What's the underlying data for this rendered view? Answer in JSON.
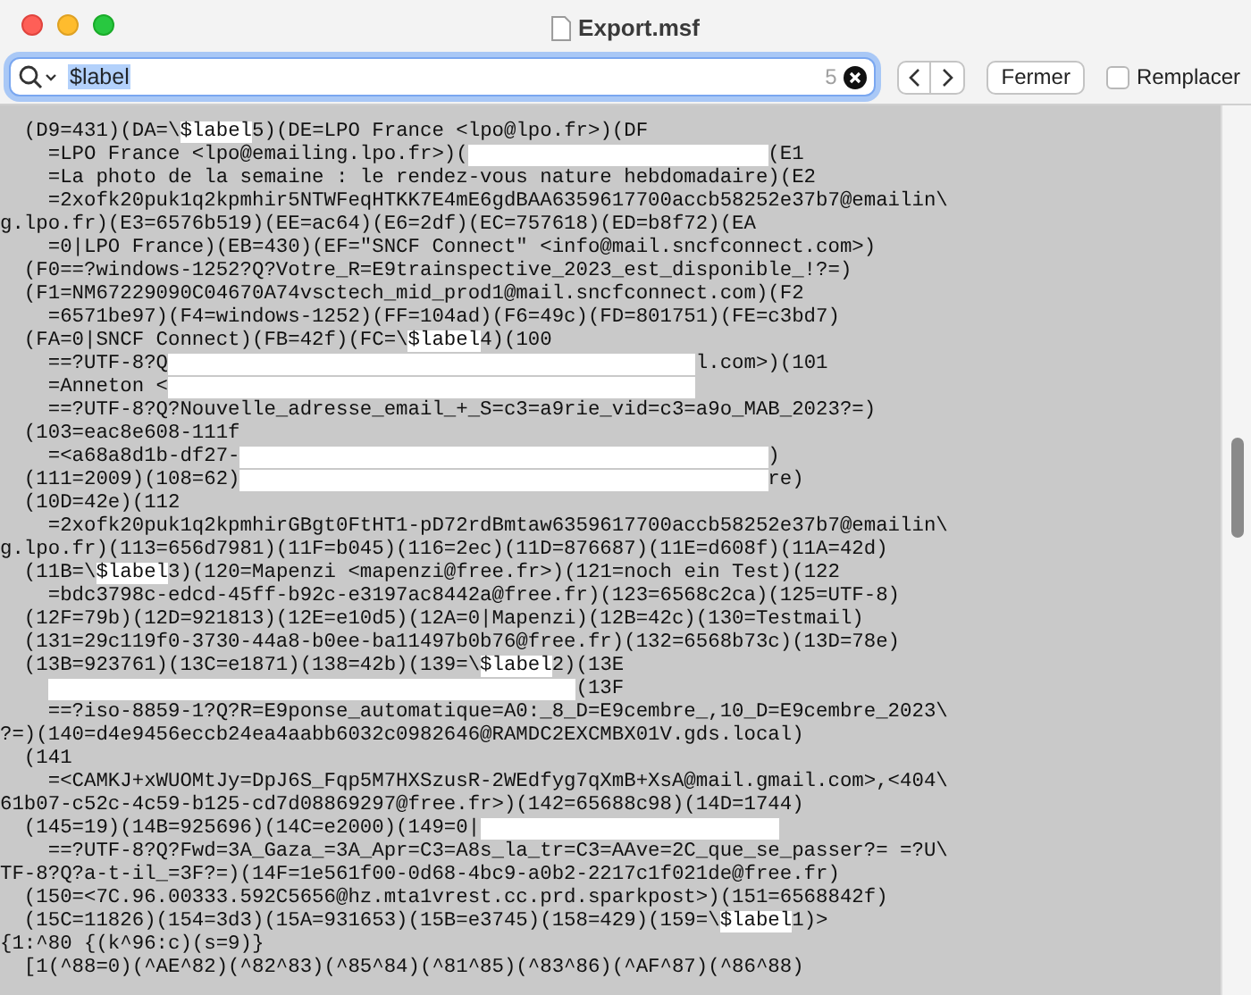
{
  "window": {
    "title": "Export.msf"
  },
  "find_bar": {
    "query": "$label",
    "match_count": "5",
    "close_button": "Fermer",
    "replace": {
      "label": "Remplacer",
      "checked": false
    }
  },
  "text_lines": [
    {
      "segments": [
        {
          "kind": "text",
          "text": "  (D9=431)(DA=\\"
        },
        {
          "kind": "match",
          "text": "$label"
        },
        {
          "kind": "text",
          "text": "5)(DE=LPO France <lpo@lpo.fr>)(DF"
        }
      ]
    },
    {
      "segments": [
        {
          "kind": "text",
          "text": "    =LPO France <lpo@emailing.lpo.fr>)("
        },
        {
          "kind": "redacted-short"
        },
        {
          "kind": "text",
          "text": "(E1"
        }
      ]
    },
    {
      "segments": [
        {
          "kind": "text",
          "text": "    =La photo de la semaine : le rendez-vous nature hebdomadaire)(E2"
        }
      ]
    },
    {
      "segments": [
        {
          "kind": "text",
          "text": "    =2xofk20puk1q2kpmhir5NTWFeqHTKK7E4mE6gdBAA6359617700accb58252e37b7@emailin\\"
        }
      ]
    },
    {
      "segments": [
        {
          "kind": "text",
          "text": "g.lpo.fr)(E3=6576b519)(EE=ac64)(E6=2df)(EC=757618)(ED=b8f72)(EA"
        }
      ]
    },
    {
      "segments": [
        {
          "kind": "text",
          "text": "    =0|LPO France)(EB=430)(EF=\"SNCF Connect\" <info@mail.sncfconnect.com>)"
        }
      ]
    },
    {
      "segments": [
        {
          "kind": "text",
          "text": "  (F0==?windows-1252?Q?Votre_R=E9trainspective_2023_est_disponible_!?=)"
        }
      ]
    },
    {
      "segments": [
        {
          "kind": "text",
          "text": "  (F1=NM67229090C04670A74vsctech_mid_prod1@mail.sncfconnect.com)(F2"
        }
      ]
    },
    {
      "segments": [
        {
          "kind": "text",
          "text": "    =6571be97)(F4=windows-1252)(FF=104ad)(F6=49c)(FD=801751)(FE=c3bd7)"
        }
      ]
    },
    {
      "segments": [
        {
          "kind": "text",
          "text": "  (FA=0|SNCF Connect)(FB=42f)(FC=\\"
        },
        {
          "kind": "match",
          "text": "$label"
        },
        {
          "kind": "text",
          "text": "4)(100"
        }
      ]
    },
    {
      "segments": [
        {
          "kind": "text",
          "text": "    ==?UTF-8?Q"
        },
        {
          "kind": "redacted"
        },
        {
          "kind": "text",
          "text": "l.com>)(101"
        }
      ]
    },
    {
      "segments": [
        {
          "kind": "text",
          "text": "    =Anneton <"
        },
        {
          "kind": "redacted"
        }
      ]
    },
    {
      "segments": [
        {
          "kind": "text",
          "text": "    ==?UTF-8?Q?Nouvelle_adresse_email_+_S=c3=a9rie_vid=c3=a9o_MAB_2023?=)"
        }
      ]
    },
    {
      "segments": [
        {
          "kind": "text",
          "text": "  (103=eac8e608-111f"
        }
      ]
    },
    {
      "segments": [
        {
          "kind": "text",
          "text": "    =<a68a8d1b-df27-"
        },
        {
          "kind": "redacted"
        },
        {
          "kind": "text",
          "text": ")"
        }
      ]
    },
    {
      "segments": [
        {
          "kind": "text",
          "text": "  (111=2009)(108=62)"
        },
        {
          "kind": "redacted"
        },
        {
          "kind": "text",
          "text": "re)"
        }
      ]
    },
    {
      "segments": [
        {
          "kind": "text",
          "text": "  (10D=42e)(112"
        }
      ]
    },
    {
      "segments": [
        {
          "kind": "text",
          "text": "    =2xofk20puk1q2kpmhirGBgt0FtHT1-pD72rdBmtaw6359617700accb58252e37b7@emailin\\"
        }
      ]
    },
    {
      "segments": [
        {
          "kind": "text",
          "text": "g.lpo.fr)(113=656d7981)(11F=b045)(116=2ec)(11D=876687)(11E=d608f)(11A=42d)"
        }
      ]
    },
    {
      "segments": [
        {
          "kind": "text",
          "text": "  (11B=\\"
        },
        {
          "kind": "match",
          "text": "$label"
        },
        {
          "kind": "text",
          "text": "3)(120=Mapenzi <mapenzi@free.fr>)(121=noch ein Test)(122"
        }
      ]
    },
    {
      "segments": [
        {
          "kind": "text",
          "text": "    =bdc3798c-edcd-45ff-b92c-e3197ac8442a@free.fr)(123=6568c2ca)(125=UTF-8)"
        }
      ]
    },
    {
      "segments": [
        {
          "kind": "text",
          "text": "  (12F=79b)(12D=921813)(12E=e10d5)(12A=0|Mapenzi)(12B=42c)(130=Testmail)"
        }
      ]
    },
    {
      "segments": [
        {
          "kind": "text",
          "text": "  (131=29c119f0-3730-44a8-b0ee-ba11497b0b76@free.fr)(132=6568b73c)(13D=78e)"
        }
      ]
    },
    {
      "segments": [
        {
          "kind": "text",
          "text": "  (13B=923761)(13C=e1871)(138=42b)(139=\\"
        },
        {
          "kind": "match",
          "text": "$label"
        },
        {
          "kind": "text",
          "text": "2)(13E"
        }
      ]
    },
    {
      "indent": true,
      "segments": [
        {
          "kind": "redacted"
        },
        {
          "kind": "text",
          "text": "(13F"
        }
      ]
    },
    {
      "segments": [
        {
          "kind": "text",
          "text": "    ==?iso-8859-1?Q?R=E9ponse_automatique=A0:_8_D=E9cembre_,10_D=E9cembre_2023\\"
        }
      ]
    },
    {
      "segments": [
        {
          "kind": "text",
          "text": "?=)(140=d4e9456eccb24ea4aabb6032c0982646@RAMDC2EXCMBX01V.gds.local)"
        }
      ]
    },
    {
      "segments": [
        {
          "kind": "text",
          "text": "  (141"
        }
      ]
    },
    {
      "segments": [
        {
          "kind": "text",
          "text": "    =<CAMKJ+xWUOMtJy=DpJ6S_Fqp5M7HXSzusR-2WEdfyg7qXmB+XsA@mail.gmail.com>,<404\\"
        }
      ]
    },
    {
      "segments": [
        {
          "kind": "text",
          "text": "61b07-c52c-4c59-b125-cd7d08869297@free.fr>)(142=65688c98)(14D=1744)"
        }
      ]
    },
    {
      "segments": [
        {
          "kind": "text",
          "text": "  (145=19)(14B=925696)(14C=e2000)(149=0|"
        },
        {
          "kind": "redacted-short"
        }
      ]
    },
    {
      "segments": [
        {
          "kind": "text",
          "text": "    ==?UTF-8?Q?Fwd=3A_Gaza_=3A_Apr=C3=A8s_la_tr=C3=AAve=2C_que_se_passer?= =?U\\"
        }
      ]
    },
    {
      "segments": [
        {
          "kind": "text",
          "text": "TF-8?Q?a-t-il_=3F?=)(14F=1e561f00-0d68-4bc9-a0b2-2217c1f021de@free.fr)"
        }
      ]
    },
    {
      "segments": [
        {
          "kind": "text",
          "text": "  (150=<7C.96.00333.592C5656@hz.mta1vrest.cc.prd.sparkpost>)(151=6568842f)"
        }
      ]
    },
    {
      "segments": [
        {
          "kind": "text",
          "text": "  (15C=11826)(154=3d3)(15A=931653)(15B=e3745)(158=429)(159=\\"
        },
        {
          "kind": "match",
          "text": "$label"
        },
        {
          "kind": "text",
          "text": "1)>"
        }
      ]
    },
    {
      "segments": [
        {
          "kind": "text",
          "text": "{1:^80 {(k^96:c)(s=9)}"
        }
      ]
    },
    {
      "segments": [
        {
          "kind": "text",
          "text": "  [1(^88=0)(^AE^82)(^82^83)(^85^84)(^81^85)(^83^86)(^AF^87)(^86^88)"
        }
      ]
    }
  ]
}
